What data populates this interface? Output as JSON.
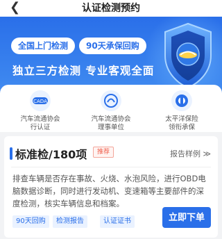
{
  "header": {
    "back_icon": "chevron-left-icon",
    "title": "认证检测预约"
  },
  "hero": {
    "pills": [
      "全国上门检测",
      "90天承保回购"
    ],
    "headline": "独立三方检测  专业客观全面",
    "shield_icon": "shield-logo-icon"
  },
  "badges": [
    {
      "icon": "association-logo-icon",
      "lines": [
        "汽车流通协会",
        "行认证"
      ]
    },
    {
      "icon": "council-logo-icon",
      "lines": [
        "汽车流通协会",
        "理事单位"
      ]
    },
    {
      "icon": "pacific-insurance-logo-icon",
      "lines": [
        "太平洋保险",
        "领衔承保"
      ]
    }
  ],
  "card": {
    "package_name": "标准检/180项",
    "recommend_tag": "推荐",
    "sample_link": "报告样例 ≫",
    "description": "排查车辆是否存在事故、火烧、水泡风险，进行OBD电脑数据诊断，同时进行发动机、变速箱等主要部件的深度检测，核实车辆信息和档案。",
    "chips": [
      "90天回购",
      "检测报告",
      "认证证书"
    ],
    "order_button": "立即下单"
  },
  "colors": {
    "primary": "#2a6fe9",
    "tag_red": "#f0604d"
  }
}
